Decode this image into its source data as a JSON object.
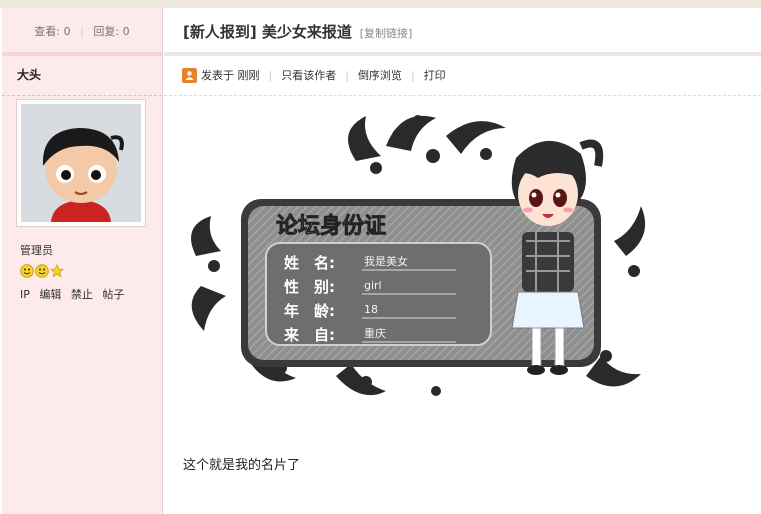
{
  "stats": {
    "views_label": "查看:",
    "views": "0",
    "replies_label": "回复:",
    "replies": "0"
  },
  "author": {
    "name": "大头",
    "role": "管理员",
    "actions": [
      "IP",
      "编辑",
      "禁止",
      "帖子"
    ]
  },
  "post": {
    "title": "[新人报到] 美少女来报道",
    "copy_link": "[复制链接]",
    "toolbar": {
      "posted": "发表于 刚刚",
      "only_author": "只看该作者",
      "reverse": "倒序浏览",
      "print": "打印"
    },
    "body": "这个就是我的名片了"
  },
  "card": {
    "heading": "论坛身份证",
    "rows": [
      {
        "label": "姓　名:",
        "value": "我是美女"
      },
      {
        "label": "性　别:",
        "value": "girl"
      },
      {
        "label": "年　龄:",
        "value": "18"
      },
      {
        "label": "来　自:",
        "value": "重庆"
      }
    ]
  },
  "icons": {
    "post_icon": "person-icon",
    "rating": [
      "smiley-icon",
      "smiley-icon",
      "star-icon"
    ]
  },
  "colors": {
    "left_bg": "#fdeaea",
    "accent_orange": "#e8832a",
    "divider_pink": "#f7d3d3"
  }
}
